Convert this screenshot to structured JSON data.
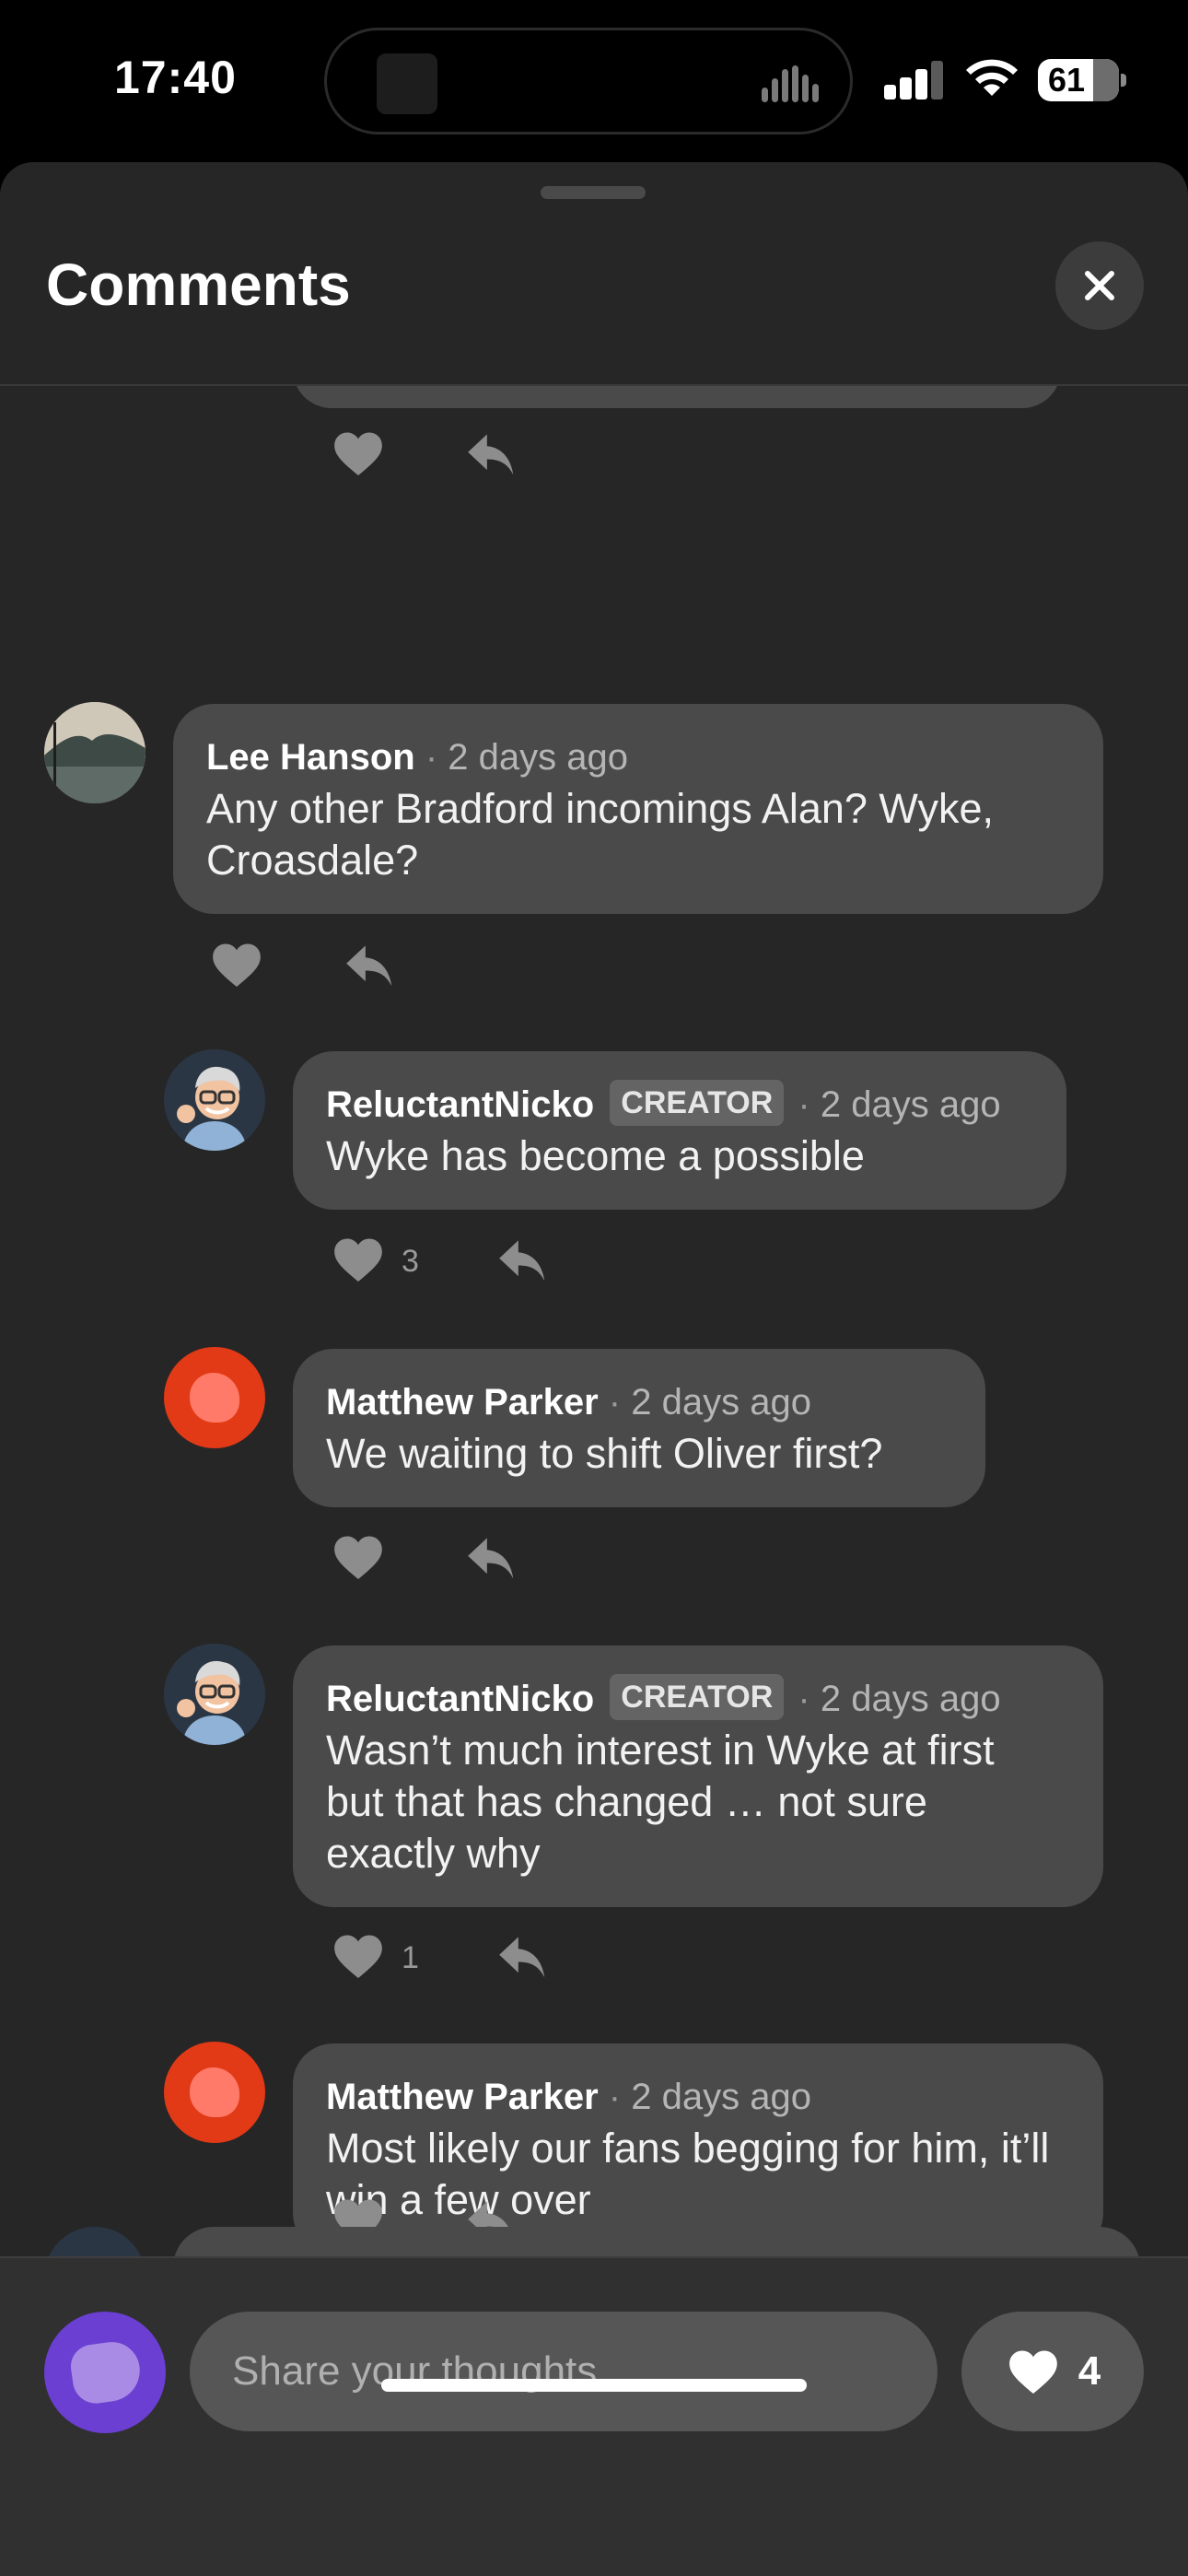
{
  "status_bar": {
    "time": "17:40",
    "battery": "61"
  },
  "sheet": {
    "title": "Comments"
  },
  "comments": [
    {
      "author": "Lee Hanson",
      "ago": "2 days ago",
      "text": "Any other Bradford incomings Alan? Wyke, Croasdale?",
      "likes": null,
      "avatar": "lake-photo",
      "creator": false
    },
    {
      "author": "ReluctantNicko",
      "badge": "CREATOR",
      "ago": "2 days ago",
      "text": "Wyke has become a possible",
      "likes": "3",
      "avatar": "memoji",
      "creator": true
    },
    {
      "author": "Matthew Parker",
      "ago": "2 days ago",
      "text": "We waiting to shift Oliver first?",
      "likes": null,
      "avatar": "red-blob",
      "creator": false
    },
    {
      "author": "ReluctantNicko",
      "badge": "CREATOR",
      "ago": "2 days ago",
      "text": "Wasn’t much interest in Wyke at first but that has changed … not sure exactly why",
      "likes": "1",
      "avatar": "memoji",
      "creator": true
    },
    {
      "author": "Matthew Parker",
      "ago": "2 days ago",
      "text": "Most likely our fans begging for him, it’ll win a few over",
      "likes": null,
      "avatar": "red-blob",
      "creator": false
    }
  ],
  "composer": {
    "placeholder": "Share your thoughts",
    "like_total": "4"
  },
  "icons": [
    "close-icon",
    "heart-icon",
    "reply-icon",
    "signal-icon",
    "wifi-icon",
    "battery-icon"
  ],
  "colors": {
    "sheet_background": "#262626",
    "bubble": "#4a4a4a",
    "user_avatar": "#6a3fd1",
    "red_avatar": "#e23a16"
  }
}
